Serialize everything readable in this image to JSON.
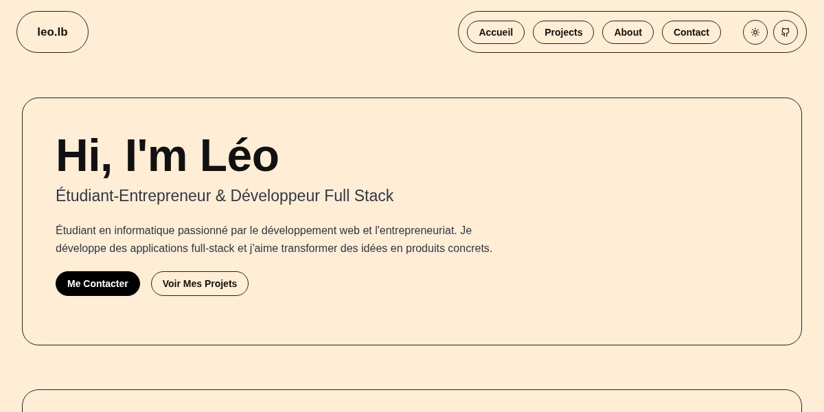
{
  "logo": "leo.lb",
  "nav": {
    "links": [
      "Accueil",
      "Projects",
      "About",
      "Contact"
    ],
    "icons": [
      {
        "kind": "theme"
      },
      {
        "kind": "github"
      }
    ]
  },
  "hero": {
    "title": "Hi, I'm Léo",
    "subtitle": "Étudiant-Entrepreneur & Développeur Full Stack",
    "description": "Étudiant en informatique passionné par le développement web et l'entrepreneuriat. Je développe des applications full-stack et j'aime transformer des idées en produits concrets.",
    "buttons": [
      {
        "label": "Me Contacter",
        "kind": "primary"
      },
      {
        "label": "Voir Mes Projets",
        "kind": "outline"
      }
    ]
  }
}
